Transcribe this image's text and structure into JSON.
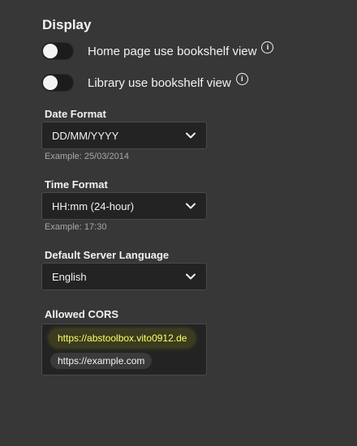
{
  "display": {
    "title": "Display",
    "toggles": [
      {
        "label": "Home page use bookshelf view",
        "enabled": false,
        "info_icon": "info-icon"
      },
      {
        "label": "Library use bookshelf view",
        "enabled": false,
        "info_icon": "info-icon"
      }
    ]
  },
  "date_format": {
    "label": "Date Format",
    "value": "DD/MM/YYYY",
    "example": "Example: 25/03/2014"
  },
  "time_format": {
    "label": "Time Format",
    "value": "HH:mm (24-hour)",
    "example": "Example: 17:30"
  },
  "server_language": {
    "label": "Default Server Language",
    "value": "English"
  },
  "allowed_cors": {
    "label": "Allowed CORS",
    "entries": [
      "https://abstoolbox.vito0912.de",
      "https://example.com"
    ]
  },
  "colors": {
    "background": "#373737",
    "field_background": "#232323",
    "highlight_text": "#ffff66"
  }
}
